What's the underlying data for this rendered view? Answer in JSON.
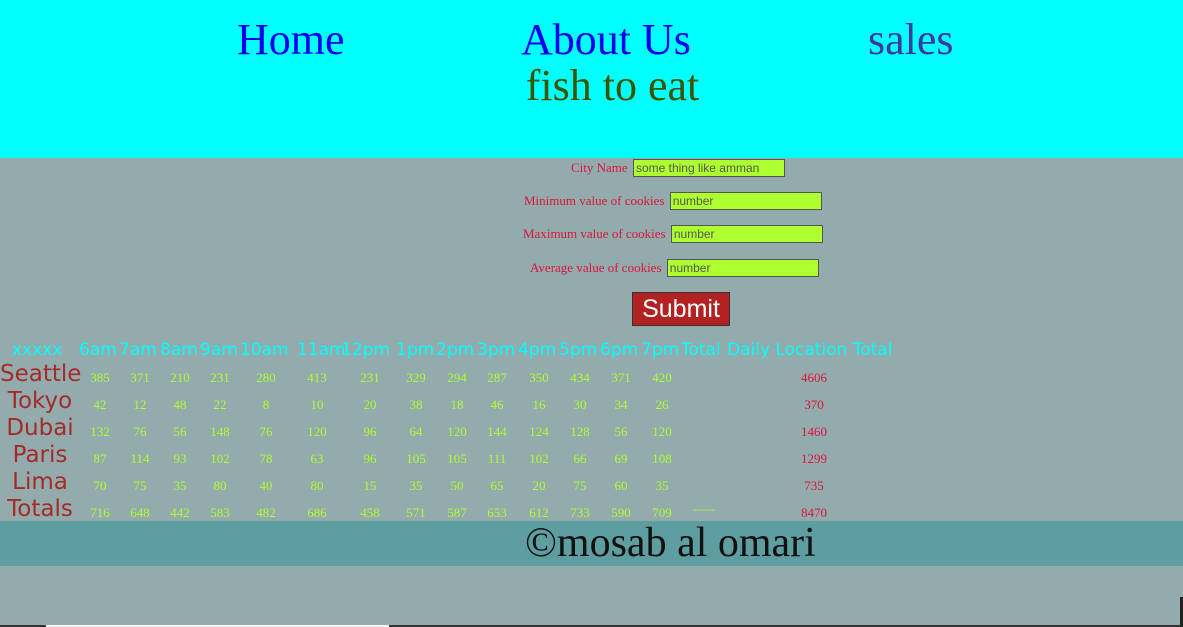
{
  "nav": {
    "home": "Home",
    "about": "About Us",
    "sales": "sales"
  },
  "page_title": "fish to eat",
  "form": {
    "city_label": "City Name",
    "city_placeholder": "some thing like amman",
    "min_label": "Minimum value of cookies",
    "min_placeholder": "number",
    "max_label": "Maximum value of cookies",
    "max_placeholder": "number",
    "avg_label": "Average value of cookies",
    "avg_placeholder": "number",
    "submit_label": "Submit"
  },
  "table": {
    "corner": "xxxxx",
    "hours": [
      "6am",
      "7am",
      "8am",
      "9am",
      "10am",
      "11am",
      "12pm",
      "1pm",
      "2pm",
      "3pm",
      "4pm",
      "5pm",
      "6pm",
      "7pm"
    ],
    "total_header": "Total",
    "daily_total_header": "Daily Location Total",
    "rows": [
      {
        "city": "Seattle",
        "values": [
          "385",
          "371",
          "210",
          "231",
          "280",
          "413",
          "231",
          "329",
          "294",
          "287",
          "350",
          "434",
          "371",
          "420"
        ],
        "total": "4606"
      },
      {
        "city": "Tokyo",
        "values": [
          "42",
          "12",
          "48",
          "22",
          "8",
          "10",
          "20",
          "38",
          "18",
          "46",
          "16",
          "30",
          "34",
          "26"
        ],
        "total": "370"
      },
      {
        "city": "Dubai",
        "values": [
          "132",
          "76",
          "56",
          "148",
          "76",
          "120",
          "96",
          "64",
          "120",
          "144",
          "124",
          "128",
          "56",
          "120"
        ],
        "total": "1460"
      },
      {
        "city": "Paris",
        "values": [
          "87",
          "114",
          "93",
          "102",
          "78",
          "63",
          "96",
          "105",
          "105",
          "111",
          "102",
          "66",
          "69",
          "108"
        ],
        "total": "1299"
      },
      {
        "city": "Lima",
        "values": [
          "70",
          "75",
          "35",
          "80",
          "40",
          "80",
          "15",
          "35",
          "50",
          "65",
          "20",
          "75",
          "60",
          "35"
        ],
        "total": "735"
      }
    ],
    "totals_label": "Totals",
    "totals": [
      "716",
      "648",
      "442",
      "583",
      "482",
      "686",
      "458",
      "571",
      "587",
      "653",
      "612",
      "733",
      "590",
      "709"
    ],
    "totals_separator": "=====",
    "grand_total": "8470"
  },
  "footer": {
    "text": "©mosab al omari"
  },
  "colors": {
    "header_bg": "#00ffff",
    "page_bg": "#93abac",
    "footer_bg": "#5f9ea0",
    "label_red": "#dc143c",
    "input_green": "#adff2f",
    "button_red": "#b22222"
  }
}
